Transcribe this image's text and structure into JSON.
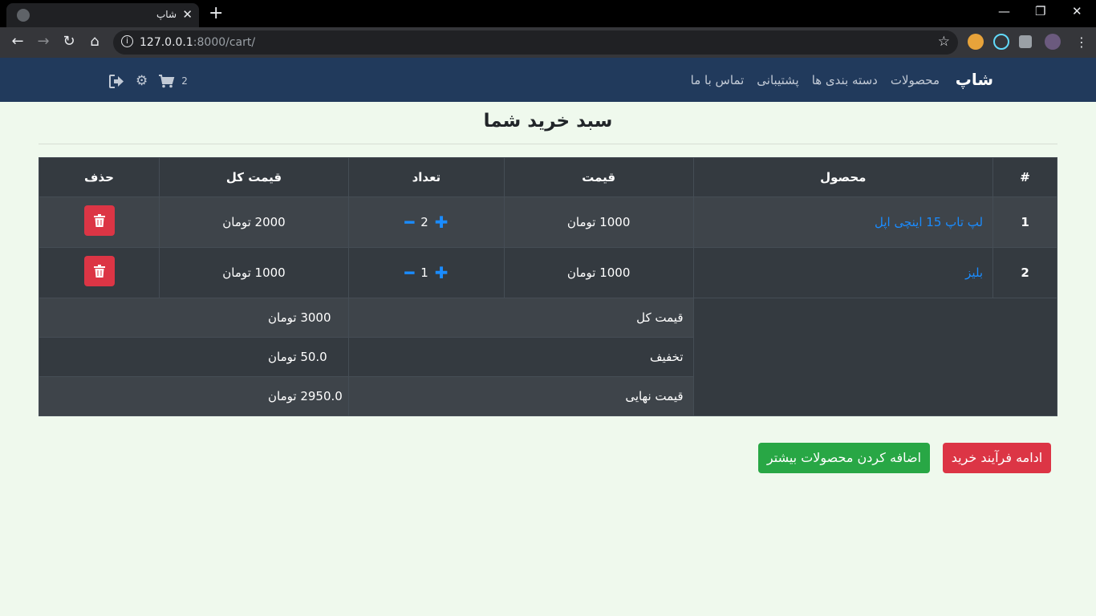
{
  "browser": {
    "tab_title": "شاپ",
    "url_host": "127.0.0.1",
    "url_path": ":8000/cart/"
  },
  "site": {
    "brand": "شاپ",
    "nav": [
      "محصولات",
      "دسته بندی ها",
      "پشتیبانی",
      "تماس با ما"
    ],
    "cart_count": "2"
  },
  "cart": {
    "title": "سبد خرید شما",
    "headers": {
      "index": "#",
      "product": "محصول",
      "price": "قیمت",
      "quantity": "تعداد",
      "total": "قیمت کل",
      "delete": "حذف"
    },
    "items": [
      {
        "index": "1",
        "product": "لپ تاپ 15 اینچی اپل",
        "price": "1000 تومان",
        "quantity": "2",
        "total": "2000 تومان"
      },
      {
        "index": "2",
        "product": "بلیز",
        "price": "1000 تومان",
        "quantity": "1",
        "total": "1000 تومان"
      }
    ],
    "summary": [
      {
        "label": "قیمت کل",
        "value": "3000 تومان"
      },
      {
        "label": "تخفیف",
        "value": "50.0 تومان"
      },
      {
        "label": "قیمت نهایی",
        "value": "2950.0 تومان"
      }
    ]
  },
  "buttons": {
    "checkout": "ادامه فرآیند خرید",
    "add_more": "اضافه کردن محصولات بیشتر"
  },
  "colors": {
    "navbar": "#213a5c",
    "page_bg": "#eff9ed",
    "danger": "#dc3545",
    "success": "#28a745",
    "link": "#1a8cff"
  }
}
